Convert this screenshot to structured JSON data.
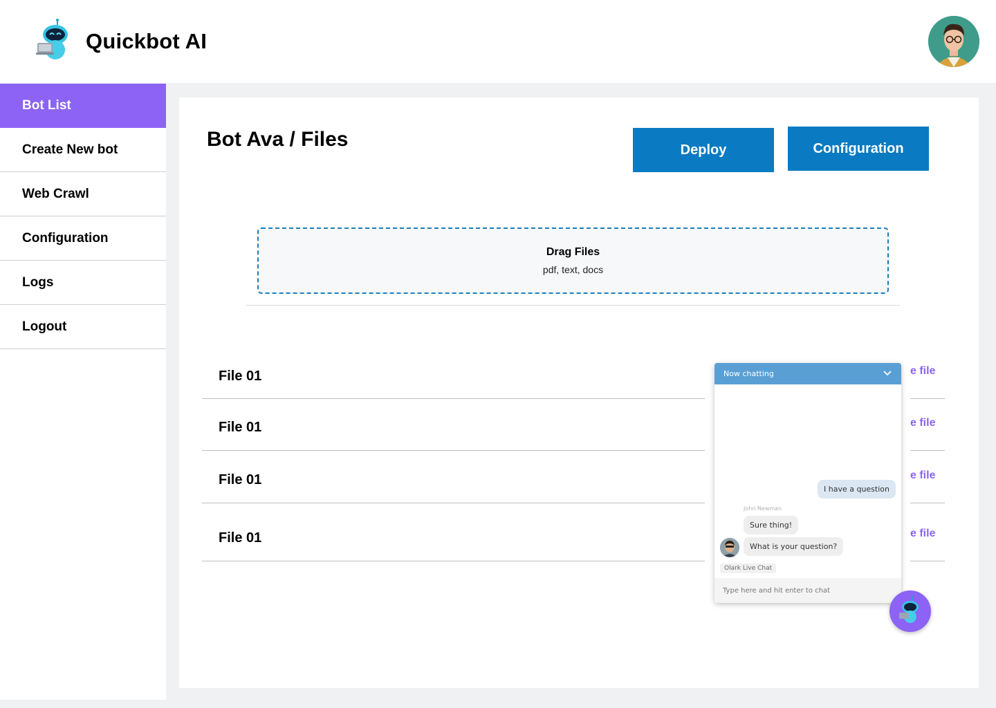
{
  "app": {
    "title": "Quickbot AI"
  },
  "sidebar": {
    "items": [
      {
        "label": "Bot List",
        "active": true
      },
      {
        "label": "Create New bot"
      },
      {
        "label": "Web Crawl"
      },
      {
        "label": "Configuration"
      },
      {
        "label": "Logs"
      },
      {
        "label": "Logout"
      }
    ]
  },
  "main": {
    "title": "Bot Ava / Files",
    "deploy_label": "Deploy",
    "config_label": "Configuration",
    "dropzone": {
      "title": "Drag Files",
      "subtitle": "pdf, text, docs"
    },
    "files": [
      {
        "name": "File 01",
        "action": "e file"
      },
      {
        "name": "File 01",
        "action": "e file"
      },
      {
        "name": "File 01",
        "action": "e file"
      },
      {
        "name": "File 01",
        "action": "e file"
      }
    ]
  },
  "chat": {
    "header": "Now chatting",
    "messages": {
      "me": "I have a question",
      "agent_name": "John Newman",
      "agent_1": "Sure thing!",
      "agent_2": "What is your question?"
    },
    "brand": "Olark Live Chat",
    "input_placeholder": "Type here and hit enter to chat"
  },
  "colors": {
    "accent": "#8c63f4",
    "primary_button": "#0a7bc2",
    "chat_header": "#5a9fd4",
    "dropzone_border": "#1a7fb7"
  },
  "icons": {
    "logo": "robot-logo-icon",
    "chat_toggle": "chevron-down-icon",
    "fab": "robot-chat-icon"
  }
}
